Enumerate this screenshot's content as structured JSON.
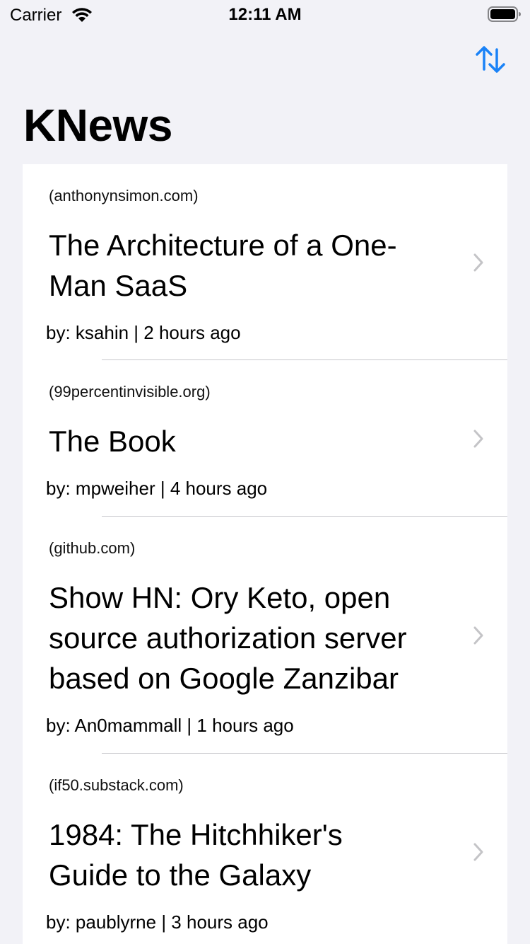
{
  "status_bar": {
    "carrier": "Carrier",
    "time": "12:11 AM",
    "icons": [
      "wifi-icon",
      "battery-icon"
    ]
  },
  "nav": {
    "sort_icon": "sort-arrows-icon",
    "accent_color": "#1a82f7",
    "title": "KNews"
  },
  "stories": [
    {
      "domain": "(anthonynsimon.com)",
      "title_lines": [
        "The Architecture of a One-",
        "Man SaaS"
      ],
      "meta": "by: ksahin | 2 hours ago"
    },
    {
      "domain": "(99percentinvisible.org)",
      "title_lines": [
        "The Book"
      ],
      "meta": "by: mpweiher | 4 hours ago"
    },
    {
      "domain": "(github.com)",
      "title_lines": [
        "Show HN: Ory Keto, open",
        "source authorization server",
        "based on Google Zanzibar"
      ],
      "meta": "by: An0mammall | 1 hours ago"
    },
    {
      "domain": "(if50.substack.com)",
      "title_lines": [
        "1984: The Hitchhiker's",
        "Guide to the Galaxy"
      ],
      "meta": "by: paublyrne | 3 hours ago"
    }
  ]
}
